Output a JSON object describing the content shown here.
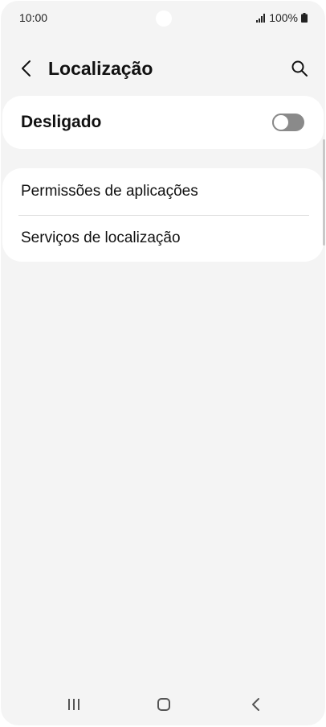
{
  "status_bar": {
    "time": "10:00",
    "battery_text": "100%",
    "icons": [
      "signal-icon",
      "battery-icon"
    ]
  },
  "app_bar": {
    "title": "Localização",
    "back_icon": "chevron-left-icon",
    "search_icon": "search-icon"
  },
  "location_master": {
    "label": "Desligado",
    "enabled": false
  },
  "settings_list": {
    "items": [
      {
        "label": "Permissões de aplicações"
      },
      {
        "label": "Serviços de localização"
      }
    ]
  },
  "navigation_bar": {
    "icons": [
      "recents-icon",
      "home-icon",
      "back-icon"
    ]
  },
  "colors": {
    "background": "#f4f4f4",
    "card": "#ffffff",
    "toggle_off": "#8a8a8a",
    "text": "#111111"
  }
}
